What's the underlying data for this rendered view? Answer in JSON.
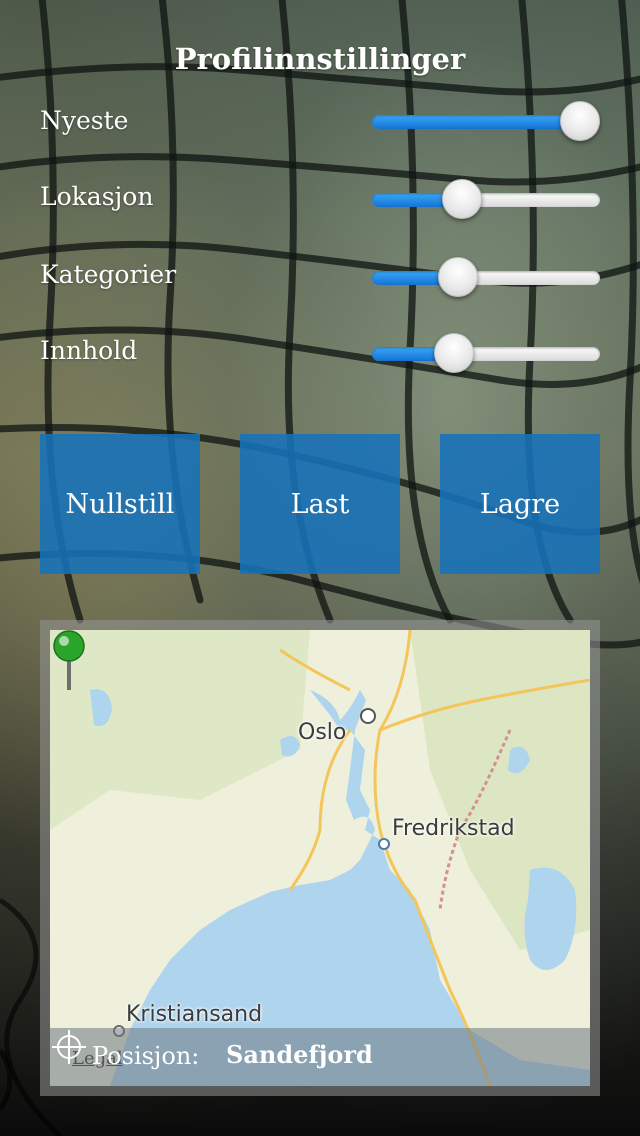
{
  "title": "Profilinnstillinger",
  "sliders": [
    {
      "label": "Nyeste",
      "value": 1.0
    },
    {
      "label": "Lokasjon",
      "value": 0.37
    },
    {
      "label": "Kategorier",
      "value": 0.35
    },
    {
      "label": "Innhold",
      "value": 0.33
    }
  ],
  "buttons": {
    "reset": "Nullstill",
    "load": "Last",
    "save": "Lagre"
  },
  "map": {
    "cities": {
      "oslo": "Oslo",
      "fredrikstad": "Fredrikstad",
      "kristiansand": "Kristiansand"
    },
    "legal": "Legal",
    "position_label": "Posisjon:",
    "position_value": "Sandefjord",
    "pin_color": "#2aa52a",
    "water_color": "#aed4ee"
  },
  "colors": {
    "button_bg": "#1772ba",
    "slider_fill": "#2b8ff0"
  }
}
